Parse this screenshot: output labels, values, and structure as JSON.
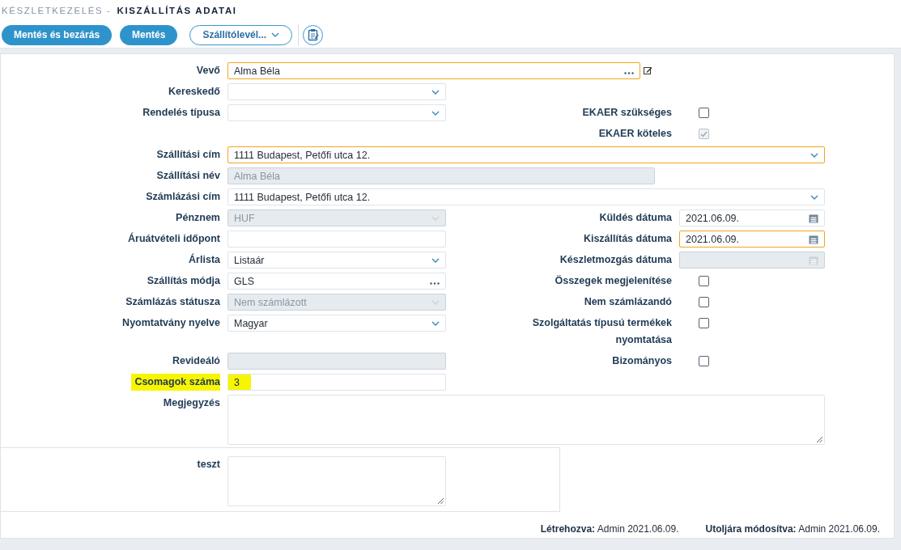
{
  "breadcrumb": {
    "parent": "KÉSZLETKEZELÉS -",
    "title": "KISZÁLLÍTÁS ADATAI"
  },
  "toolbar": [
    {
      "kind": "primary",
      "label": "Mentés és bezárás"
    },
    {
      "kind": "primary",
      "label": "Mentés"
    },
    {
      "kind": "dropdown",
      "label": "Szállítólevél..."
    },
    {
      "kind": "icon"
    }
  ],
  "form": {
    "rows": [
      {
        "left": {
          "label": "Vevő",
          "kind": "lookup",
          "value": "Alma Béla",
          "wide": true,
          "disabled": false,
          "focused": true,
          "edit_button": true,
          "highlighted": false
        }
      },
      {
        "left": {
          "label": "Kereskedő",
          "kind": "select",
          "wide": false,
          "disabled": false,
          "focused": false,
          "highlighted": false
        }
      },
      {
        "left": {
          "label": "Rendelés típusa",
          "kind": "select",
          "wide": false,
          "disabled": false,
          "focused": false,
          "highlighted": false
        },
        "right": {
          "label": "EKAER szükséges",
          "kind": "checkbox",
          "checked": false,
          "disabled": false
        }
      },
      {
        "right": {
          "label": "EKAER köteles",
          "kind": "checkbox",
          "checked": true,
          "disabled": true
        }
      },
      {
        "left": {
          "label": "Szállítási cím",
          "kind": "select",
          "value": "1111 Budapest, Petőfi utca 12.",
          "wide": true,
          "disabled": false,
          "focused": true,
          "highlighted": false
        }
      },
      {
        "left": {
          "label": "Szállítási név",
          "kind": "text",
          "value": "Alma Béla",
          "wide": true,
          "disabled": true,
          "focused": false,
          "highlighted": false
        }
      },
      {
        "left": {
          "label": "Számlázási cím",
          "kind": "select",
          "value": "1111 Budapest, Petőfi utca 12.",
          "wide": true,
          "disabled": false,
          "focused": false,
          "highlighted": false
        }
      },
      {
        "left": {
          "label": "Pénznem",
          "kind": "select",
          "value": "HUF",
          "wide": false,
          "disabled": true,
          "focused": false,
          "highlighted": false
        },
        "right": {
          "label": "Küldés dátuma",
          "kind": "date",
          "value": "2021.06.09.",
          "disabled": false,
          "focused": false
        }
      },
      {
        "left": {
          "label": "Áruátvételi időpont",
          "kind": "text",
          "wide": false,
          "disabled": false,
          "focused": false,
          "highlighted": false
        },
        "right": {
          "label": "Kiszállítás dátuma",
          "kind": "date",
          "value": "2021.06.09.",
          "disabled": false,
          "focused": true
        }
      },
      {
        "left": {
          "label": "Árlista",
          "kind": "select",
          "value": "Listaár",
          "wide": false,
          "disabled": false,
          "focused": false,
          "highlighted": false
        },
        "right": {
          "label": "Készletmozgás dátuma",
          "kind": "date",
          "disabled": true,
          "focused": false
        }
      },
      {
        "left": {
          "label": "Szállítás módja",
          "kind": "lookup",
          "value": "GLS",
          "wide": false,
          "disabled": false,
          "focused": false,
          "highlighted": false
        },
        "right": {
          "label": "Összegek megjelenítése",
          "kind": "checkbox",
          "checked": false,
          "disabled": false
        }
      },
      {
        "left": {
          "label": "Számlázás státusza",
          "kind": "select",
          "value": "Nem számlázott",
          "wide": false,
          "disabled": true,
          "focused": false,
          "highlighted": false
        },
        "right": {
          "label": "Nem számlázandó",
          "kind": "checkbox",
          "checked": false,
          "disabled": false
        }
      },
      {
        "left": {
          "label": "Nyomtatvány nyelve",
          "kind": "select",
          "value": "Magyar",
          "wide": false,
          "disabled": false,
          "focused": false,
          "highlighted": false
        },
        "right": {
          "label": "Szolgáltatás típusú termékek nyomtatása",
          "kind": "checkbox",
          "checked": false,
          "disabled": false
        }
      },
      {
        "left": {
          "label": "Revideáló",
          "kind": "text",
          "wide": false,
          "disabled": true,
          "focused": false,
          "highlighted": false
        },
        "right": {
          "label": "Bizományos",
          "kind": "checkbox",
          "checked": false,
          "disabled": false
        }
      },
      {
        "left": {
          "label": "Csomagok száma",
          "kind": "text",
          "value": "3",
          "wide": false,
          "disabled": false,
          "focused": false,
          "highlighted": true
        }
      },
      {
        "left": {
          "label": "Megjegyzés",
          "kind": "textarea",
          "wide": true,
          "disabled": false,
          "focused": false,
          "highlighted": false
        }
      }
    ]
  },
  "custom_section": {
    "fields": [
      {
        "label": "teszt",
        "kind": "textarea",
        "disabled": false,
        "focused": false
      }
    ]
  },
  "footer": [
    {
      "text": "**Létrehozva:** Admin 2021.06.09."
    },
    {
      "text": "**Utoljára módosítva:** Admin 2021.06.09."
    }
  ]
}
